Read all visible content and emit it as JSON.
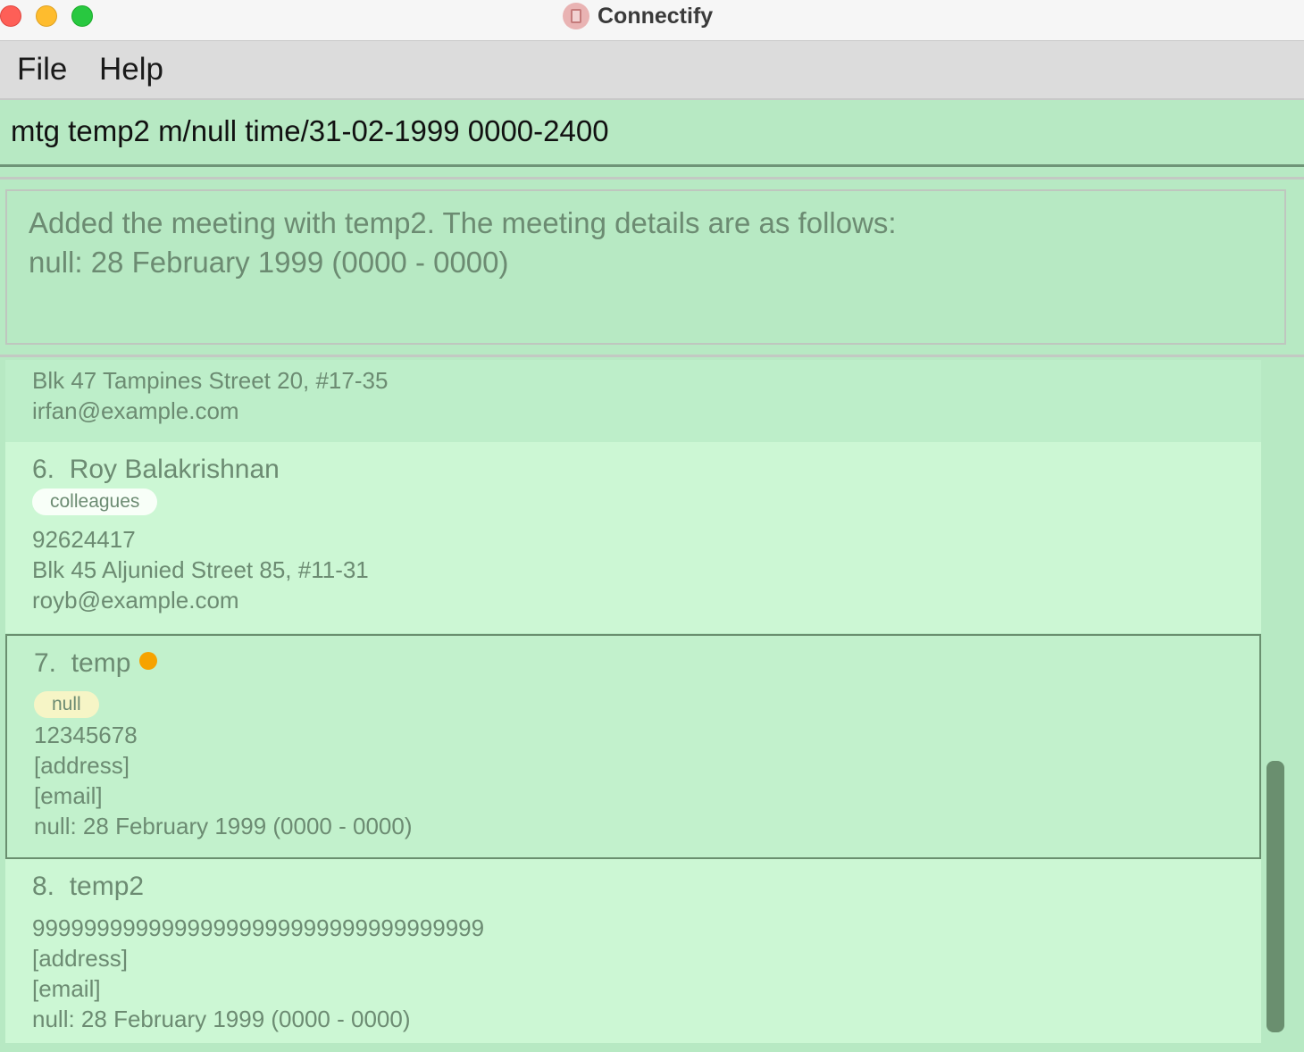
{
  "window": {
    "title": "Connectify",
    "app_icon": "notebook-icon"
  },
  "menu": {
    "file": "File",
    "help": "Help"
  },
  "command_box": {
    "value": "mtg temp2 m/null time/31-02-1999 0000-2400"
  },
  "result": {
    "line1": "Added the meeting with temp2. The meeting details are as follows:",
    "line2": "null: 28 February 1999 (0000 - 0000)"
  },
  "persons": [
    {
      "partial_address": "Blk 47 Tampines Street 20, #17-35",
      "email": "irfan@example.com"
    },
    {
      "index": "6.",
      "name": "Roy Balakrishnan",
      "tag": "colleagues",
      "phone": "92624417",
      "address": "Blk 45 Aljunied Street 85, #11-31",
      "email": "royb@example.com"
    },
    {
      "index": "7.",
      "name": "temp",
      "tag": "null",
      "phone": "12345678",
      "address": "[address]",
      "email": "[email]",
      "meeting": "null: 28 February 1999 (0000 - 0000)",
      "status_color": "#f6a300"
    },
    {
      "index": "8.",
      "name": "temp2",
      "phone": "99999999999999999999999999999999999",
      "address": "[address]",
      "email": "[email]",
      "meeting": "null: 28 February 1999 (0000 - 0000)"
    }
  ],
  "colors": {
    "background": "#b7e9c3",
    "card_light": "#ccf7d4",
    "text": "#6c8b72",
    "scroll_thumb": "#6a8f6f"
  }
}
